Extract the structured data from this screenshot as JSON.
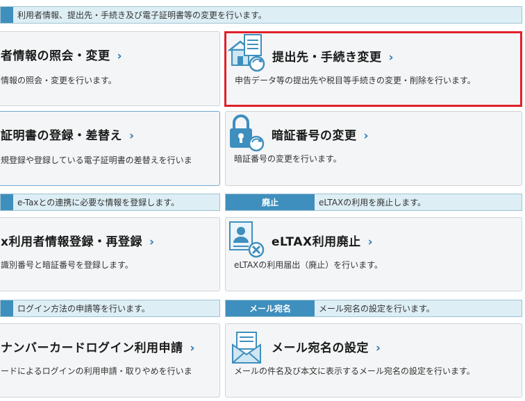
{
  "rows": [
    {
      "left_header": "利用者情報、提出先・手続き及び電子証明書等の変更を行います。",
      "cards": [
        {
          "title": "者情報の照会・変更",
          "desc": "情報の照会・変更を行います。"
        },
        {
          "title": "提出先・手続き変更",
          "desc": "申告データ等の提出先や税目等手続きの変更・削除を行います。",
          "icon": "building-document-refresh-icon",
          "selected": true
        },
        {
          "title": "証明書の登録・差替え",
          "desc": "規登録や登録している電子証明書の差替えを行いま"
        },
        {
          "title": "暗証番号の変更",
          "desc": "暗証番号の変更を行います。",
          "icon": "padlock-refresh-icon"
        }
      ]
    }
  ],
  "sections": {
    "etax": {
      "header_text": "e-Taxとの連携に必要な情報を登録します。",
      "card_title": "x利用者情報登録・再登録",
      "card_desc": "識別番号と暗証番号を登録します。"
    },
    "abolish": {
      "tag": "廃止",
      "header_text": "eLTAXの利用を廃止します。",
      "card_title": "eLTAX利用廃止",
      "card_desc": "eLTAXの利用届出（廃止）を行います。",
      "icon": "user-document-cancel-icon"
    },
    "login": {
      "header_text": "ログイン方法の申請等を行います。",
      "card_title": "ナンバーカードログイン利用申請",
      "card_desc": "ードによるログインの利用申請・取りやめを行いま"
    },
    "mail": {
      "tag": "メール宛名",
      "header_text": "メール宛名の設定を行います。",
      "card_title": "メール宛名の設定",
      "card_desc": "メールの件名及び本文に表示するメール宛名の設定を行います。",
      "icon": "envelope-icon"
    }
  },
  "chevron": "›",
  "colors": {
    "accent": "#3e8fbd",
    "header_bg": "#ddeef5",
    "selected_border": "#e0202a",
    "link": "#2a7ab5"
  }
}
